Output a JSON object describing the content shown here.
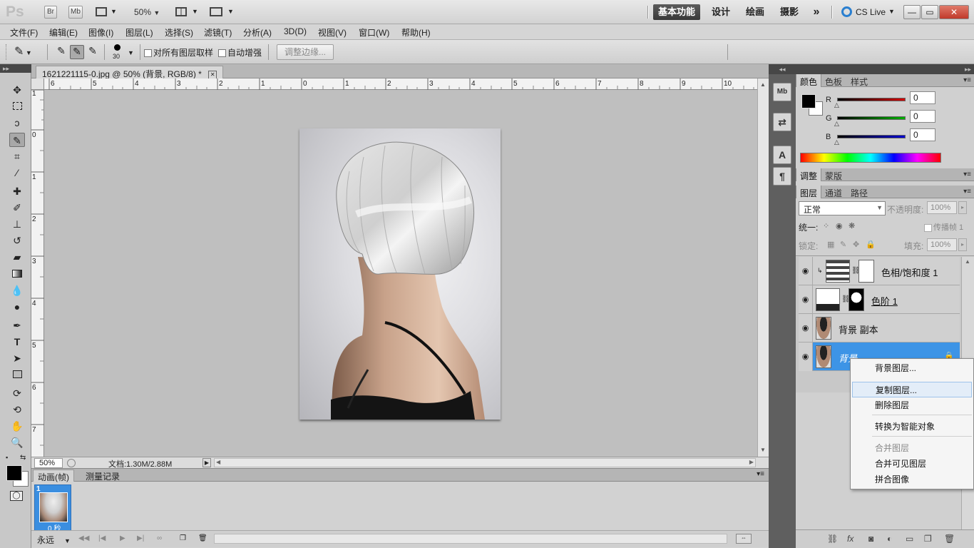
{
  "appbar": {
    "logo": "Ps",
    "bridge_label": "Br",
    "minibridge_label": "Mb",
    "zoom": "50%",
    "workspaces": [
      "基本功能",
      "设计",
      "绘画",
      "摄影"
    ],
    "more_label": "»",
    "cslive_label": "CS Live",
    "win_min": "—",
    "win_restore": "▭",
    "win_close": "✕"
  },
  "menubar": {
    "items": [
      "文件(F)",
      "编辑(E)",
      "图像(I)",
      "图层(L)",
      "选择(S)",
      "滤镜(T)",
      "分析(A)",
      "3D(D)",
      "视图(V)",
      "窗口(W)",
      "帮助(H)"
    ]
  },
  "options": {
    "brush_size": "30",
    "sample_all_layers": "对所有图层取样",
    "auto_enhance": "自动增强",
    "refine_edge": "调整边缘..."
  },
  "document": {
    "tab_title": "1621221115-0.jpg @ 50% (背景, RGB/8) *",
    "close_glyph": "✕",
    "h_ruler_labels": [
      "6",
      "5",
      "4",
      "3",
      "2",
      "1",
      "0",
      "1",
      "2",
      "3",
      "4",
      "5",
      "6",
      "7",
      "8",
      "9",
      "10"
    ],
    "v_ruler_labels": [
      "1",
      "0",
      "1",
      "2",
      "3",
      "4",
      "5",
      "6",
      "7"
    ]
  },
  "status": {
    "zoom": "50%",
    "doc_info": "文档:1.30M/2.88M"
  },
  "animation": {
    "tab_animation": "动画(帧)",
    "tab_measure": "测量记录",
    "frame_number": "1",
    "frame_delay": "0 秒",
    "loop": "永远"
  },
  "color_panel": {
    "tabs": [
      "颜色",
      "色板",
      "样式"
    ],
    "channels": [
      {
        "label": "R",
        "value": "0",
        "color": "#d40000"
      },
      {
        "label": "G",
        "value": "0",
        "color": "#00b000"
      },
      {
        "label": "B",
        "value": "0",
        "color": "#0000d0"
      }
    ]
  },
  "adjust_panel": {
    "tabs": [
      "调整",
      "蒙版"
    ]
  },
  "layers_panel": {
    "tabs": [
      "图层",
      "通道",
      "路径"
    ],
    "blend_mode": "正常",
    "opacity_label": "不透明度:",
    "opacity_value": "100%",
    "unify_label": "统一:",
    "propagate_label": "传播帧 1",
    "lock_label": "锁定:",
    "fill_label": "填充:",
    "fill_value": "100%",
    "layers": [
      {
        "name": "色相/饱和度 1",
        "type": "hue-sat"
      },
      {
        "name": "色阶 1",
        "type": "levels"
      },
      {
        "name": "背景 副本",
        "type": "photo"
      },
      {
        "name": "背景",
        "type": "photo",
        "selected": true
      }
    ]
  },
  "context_menu": {
    "items": [
      "背景图层...",
      "复制图层...",
      "删除图层",
      "转换为智能对象",
      "合并图层",
      "合并可见图层",
      "拼合图像"
    ],
    "hovered": "复制图层...",
    "disabled": [
      "合并图层"
    ]
  }
}
